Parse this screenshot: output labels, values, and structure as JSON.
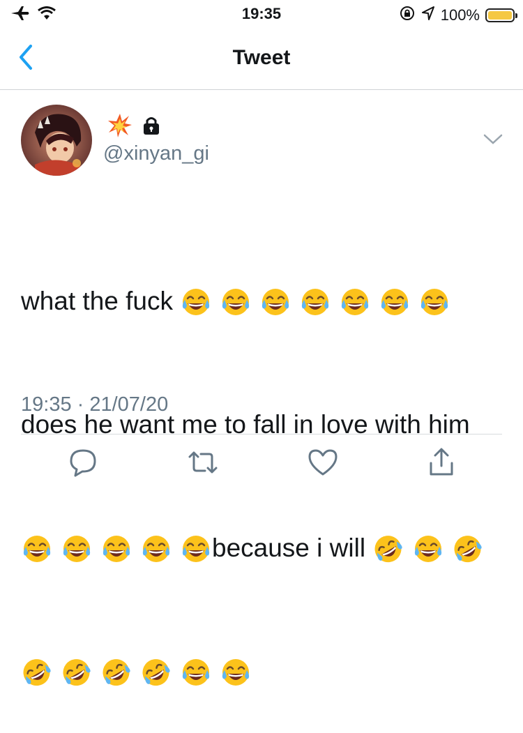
{
  "status_bar": {
    "time": "19:35",
    "battery_text": "100%",
    "battery_level": 1.0,
    "icons": [
      "airplane-icon",
      "wifi-icon",
      "orientation-lock-icon",
      "location-icon",
      "battery-icon"
    ],
    "battery_color": "#f5c842"
  },
  "nav": {
    "title": "Tweet",
    "back_icon": "chevron-left-icon",
    "accent_color": "#1da1f2"
  },
  "tweet": {
    "display_name_icons": [
      "collision-emoji",
      "lock-icon"
    ],
    "handle": "@xinyan_gi",
    "text_segments": [
      "what the fuck",
      "does he want me to fall in love with him",
      "because i will"
    ],
    "emoji": {
      "line1": [
        "joy",
        "joy",
        "joy",
        "joy",
        "joy",
        "joy",
        "joy"
      ],
      "line3_before": [
        "joy",
        "joy",
        "joy",
        "joy",
        "joy"
      ],
      "line3_after": [
        "rofl",
        "joy",
        "rofl"
      ],
      "line4": [
        "rofl",
        "rofl",
        "rofl",
        "rofl",
        "joy",
        "joy"
      ]
    },
    "timestamp": "19:35 · 21/07/20"
  },
  "actions": [
    "reply-icon",
    "retweet-icon",
    "like-icon",
    "share-icon"
  ],
  "colors": {
    "icon_gray": "#657786",
    "text": "#14171a"
  }
}
